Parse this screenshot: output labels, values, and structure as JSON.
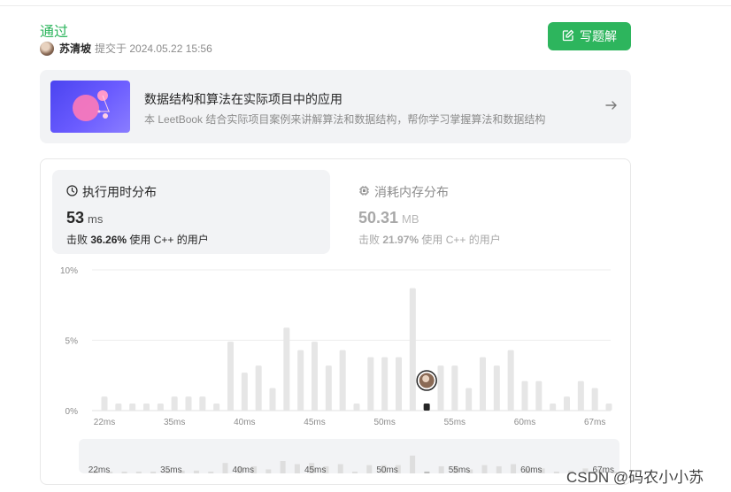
{
  "submission": {
    "status": "通过",
    "user": "苏清坡",
    "submitted_text": "提交于 2024.05.22 15:56"
  },
  "write_button": {
    "label": "写题解",
    "icon": "edit-icon"
  },
  "promo": {
    "title": "数据结构和算法在实际项目中的应用",
    "description": "本 LeetBook 结合实际项目案例来讲解算法和数据结构，帮你学习掌握算法和数据结构",
    "icon": "arrow-right-icon"
  },
  "runtime": {
    "label": "执行用时分布",
    "icon": "clock-icon",
    "value": "53",
    "unit": "ms",
    "beat_prefix": "击败",
    "beat_percent": "36.26%",
    "beat_suffix": "使用 C++ 的用户"
  },
  "memory": {
    "label": "消耗内存分布",
    "icon": "chip-icon",
    "value": "50.31",
    "unit": "MB",
    "beat_prefix": "击败",
    "beat_percent": "21.97%",
    "beat_suffix": "使用 C++ 的用户"
  },
  "chart_data": {
    "type": "bar",
    "title": "",
    "xlabel": "",
    "ylabel": "",
    "ylim": [
      0,
      10
    ],
    "y_ticks": [
      "0%",
      "5%",
      "10%"
    ],
    "x_ticks": [
      "22ms",
      "35ms",
      "40ms",
      "45ms",
      "50ms",
      "55ms",
      "60ms",
      "67ms"
    ],
    "values": [
      1.0,
      0.5,
      0.5,
      0.5,
      0.5,
      1.0,
      1.0,
      1.0,
      0.5,
      4.9,
      2.7,
      3.2,
      1.6,
      5.9,
      4.3,
      4.9,
      3.2,
      4.3,
      0.5,
      3.8,
      3.8,
      3.8,
      8.7,
      0.5,
      3.2,
      3.2,
      1.6,
      3.8,
      3.2,
      4.3,
      2.1,
      2.1,
      0.5,
      1.0,
      2.1,
      1.6,
      0.5
    ],
    "highlight_index": 23,
    "grid": true,
    "overview": {
      "x_ticks": [
        "22ms",
        "35ms",
        "40ms",
        "45ms",
        "50ms",
        "55ms",
        "60ms",
        "67ms"
      ]
    }
  },
  "watermark": "CSDN @码农小小苏"
}
